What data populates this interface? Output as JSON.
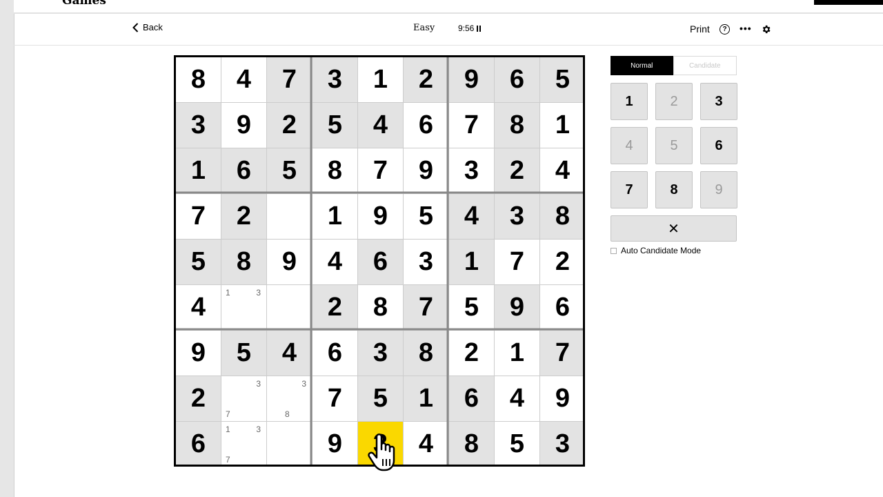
{
  "topbar": {
    "logo_text": "Games"
  },
  "header": {
    "back_label": "Back",
    "difficulty": "Easy",
    "timer": "9:56",
    "print_label": "Print"
  },
  "board": {
    "selected_cell": [
      8,
      4
    ],
    "shaded": [
      [
        0,
        0,
        1,
        1,
        0,
        1,
        1,
        1,
        1
      ],
      [
        1,
        0,
        1,
        1,
        1,
        0,
        0,
        1,
        0
      ],
      [
        1,
        1,
        1,
        0,
        0,
        0,
        0,
        1,
        0
      ],
      [
        0,
        1,
        0,
        0,
        0,
        0,
        1,
        1,
        1
      ],
      [
        1,
        1,
        0,
        0,
        1,
        0,
        1,
        0,
        0
      ],
      [
        0,
        0,
        0,
        1,
        0,
        1,
        0,
        1,
        0
      ],
      [
        0,
        1,
        1,
        0,
        1,
        1,
        0,
        0,
        1
      ],
      [
        1,
        0,
        0,
        0,
        1,
        1,
        1,
        0,
        0
      ],
      [
        1,
        0,
        0,
        0,
        0,
        0,
        1,
        0,
        1
      ]
    ],
    "rows": [
      [
        "8",
        "4",
        "7",
        "3",
        "1",
        "2",
        "9",
        "6",
        "5"
      ],
      [
        "3",
        "9",
        "2",
        "5",
        "4",
        "6",
        "7",
        "8",
        "1"
      ],
      [
        "1",
        "6",
        "5",
        "8",
        "7",
        "9",
        "3",
        "2",
        "4"
      ],
      [
        "7",
        "2",
        "",
        "1",
        "9",
        "5",
        "4",
        "3",
        "8"
      ],
      [
        "5",
        "8",
        "9",
        "4",
        "6",
        "3",
        "1",
        "7",
        "2"
      ],
      [
        "4",
        "",
        "",
        "2",
        "8",
        "7",
        "5",
        "9",
        "6"
      ],
      [
        "9",
        "5",
        "4",
        "6",
        "3",
        "8",
        "2",
        "1",
        "7"
      ],
      [
        "2",
        "",
        "",
        "7",
        "5",
        "1",
        "6",
        "4",
        "9"
      ],
      [
        "6",
        "",
        "",
        "9",
        "3",
        "4",
        "8",
        "5",
        "3"
      ]
    ],
    "notes": {
      "5-1": [
        "1",
        "3"
      ],
      "7-1": [
        "3",
        "7"
      ],
      "7-2": [
        "3",
        "8"
      ],
      "8-1": [
        "1",
        "3",
        "7"
      ]
    }
  },
  "panel": {
    "mode_normal": "Normal",
    "mode_candidate": "Candidate",
    "keys": [
      {
        "label": "1",
        "enabled": true
      },
      {
        "label": "2",
        "enabled": false
      },
      {
        "label": "3",
        "enabled": true
      },
      {
        "label": "4",
        "enabled": false
      },
      {
        "label": "5",
        "enabled": false
      },
      {
        "label": "6",
        "enabled": true
      },
      {
        "label": "7",
        "enabled": true
      },
      {
        "label": "8",
        "enabled": true
      },
      {
        "label": "9",
        "enabled": false
      }
    ],
    "erase_label": "✕",
    "auto_candidate_label": "Auto Candidate Mode"
  }
}
